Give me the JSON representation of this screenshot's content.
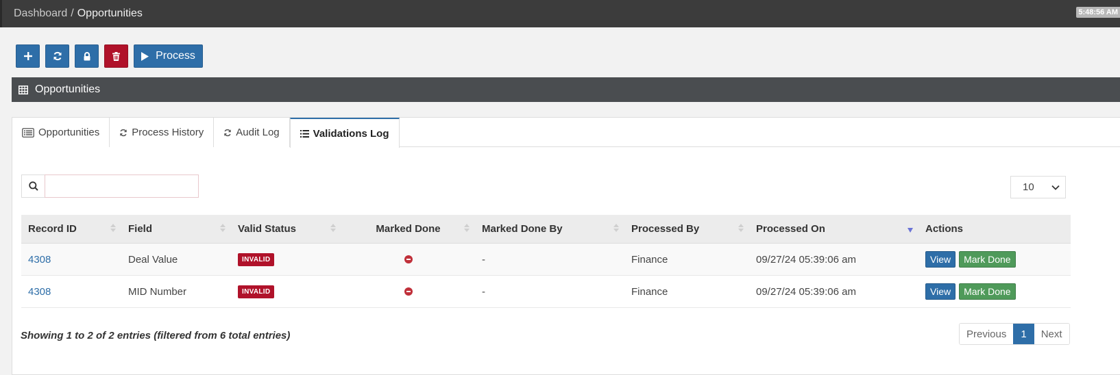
{
  "breadcrumb": {
    "parent": "Dashboard",
    "separator": "/",
    "current": "Opportunities"
  },
  "clock": "5:48:56 AM",
  "toolbar": {
    "add_icon": "plus-icon",
    "refresh_icon": "refresh-icon",
    "lock_icon": "lock-icon",
    "delete_icon": "trash-icon",
    "process_label": "Process"
  },
  "panel": {
    "title": "Opportunities"
  },
  "tabs": [
    {
      "label": "Opportunities",
      "icon": "list-alt-icon",
      "active": false
    },
    {
      "label": "Process History",
      "icon": "refresh-icon",
      "active": false
    },
    {
      "label": "Audit Log",
      "icon": "refresh-icon",
      "active": false
    },
    {
      "label": "Validations Log",
      "icon": "list-icon",
      "active": true
    }
  ],
  "search": {
    "value": "",
    "placeholder": ""
  },
  "page_length": "10",
  "table": {
    "columns": [
      "Record ID",
      "Field",
      "Valid Status",
      "Marked Done",
      "Marked Done By",
      "Processed By",
      "Processed On",
      "Actions"
    ],
    "rows": [
      {
        "record_id": "4308",
        "field": "Deal Value",
        "status": "INVALID",
        "marked_done_by": "-",
        "processed_by": "Finance",
        "processed_on": "09/27/24 05:39:06 am",
        "view": "View",
        "mark_done": "Mark Done"
      },
      {
        "record_id": "4308",
        "field": "MID Number",
        "status": "INVALID",
        "marked_done_by": "-",
        "processed_by": "Finance",
        "processed_on": "09/27/24 05:39:06 am",
        "view": "View",
        "mark_done": "Mark Done"
      }
    ]
  },
  "info": "Showing 1 to 2 of 2 entries (filtered from 6 total entries)",
  "pagination": {
    "previous": "Previous",
    "current": "1",
    "next": "Next"
  },
  "colors": {
    "primary": "#2e6ea8",
    "danger": "#b0122a",
    "success": "#4f9a5a",
    "header": "#4a4d50",
    "topbar": "#3c3c3c"
  }
}
